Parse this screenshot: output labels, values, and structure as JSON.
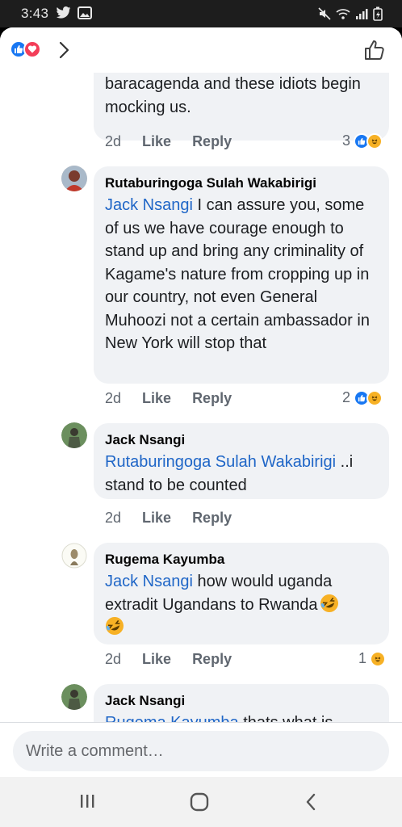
{
  "status_bar": {
    "time": "3:43"
  },
  "header": {
    "icons": [
      "like-reaction-icon",
      "love-reaction-icon",
      "chevron-right-icon",
      "thumbs-up-outline-icon"
    ]
  },
  "comments": [
    {
      "text": "baracagenda and these idiots begin mocking us.",
      "age": "2d",
      "like": "Like",
      "reply": "Reply",
      "reaction_count": "3"
    },
    {
      "author": "Rutaburingoga Sulah Wakabirigi",
      "mention": "Jack Nsangi",
      "text": " I can assure you, some of us we have courage enough to stand up and bring any criminality of Kagame's nature from cropping up in our country, not even General Muhoozi not a certain ambassador in New York will stop that",
      "age": "2d",
      "like": "Like",
      "reply": "Reply",
      "reaction_count": "2"
    },
    {
      "author": "Jack Nsangi",
      "mention": "Rutaburingoga Sulah Wakabirigi",
      "text": " ..i stand to be counted",
      "age": "2d",
      "like": "Like",
      "reply": "Reply"
    },
    {
      "author": "Rugema Kayumba",
      "mention": "Jack Nsangi",
      "text": " how would uganda extradit Ugandans to Rwanda",
      "age": "2d",
      "like": "Like",
      "reply": "Reply",
      "reaction_count": "1"
    },
    {
      "author": "Jack Nsangi",
      "mention": "Rugema Kayumba",
      "text": " thats what is"
    }
  ],
  "composer": {
    "placeholder": "Write a comment…"
  },
  "colors": {
    "mention": "#1f66c7",
    "like_blue": "#1877f2",
    "love_red": "#f33e58",
    "haha_yellow": "#f7b125",
    "bubble": "#f0f2f5"
  }
}
